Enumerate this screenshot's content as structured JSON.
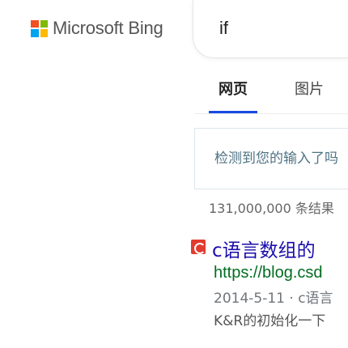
{
  "header": {
    "brand": "Microsoft Bing",
    "logo_colors": [
      "#f25022",
      "#7fba00",
      "#00a4ef",
      "#ffb900"
    ],
    "search_value": "if"
  },
  "tabs": [
    {
      "label": "网页",
      "active": true
    },
    {
      "label": "图片",
      "active": false
    }
  ],
  "accent_color": "#174ae4",
  "suggestion": {
    "text": "检测到您的输入了吗"
  },
  "result_count": "131,000,000 条结果",
  "results": [
    {
      "title": "c语言数组的",
      "url": "https://blog.csd",
      "date": "2014-5-11",
      "date_sep": "·",
      "date_text": "c语言",
      "snippet": "K&R的初始化一下"
    }
  ]
}
